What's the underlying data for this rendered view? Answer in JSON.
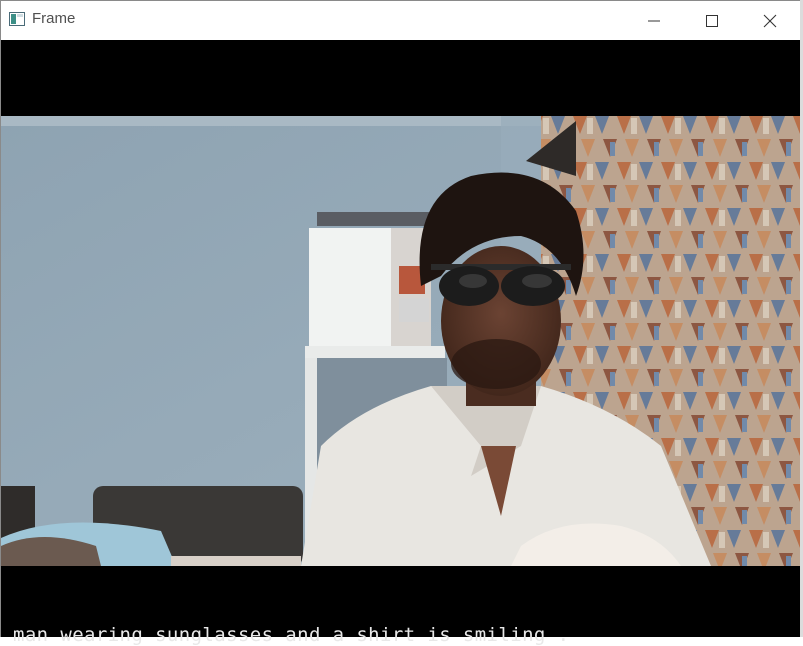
{
  "window": {
    "title": "Frame",
    "icons": {
      "app": "app-window-icon",
      "minimize": "minimize-icon",
      "maximize": "maximize-icon",
      "close": "close-icon"
    }
  },
  "video": {
    "caption": "man wearing sunglasses and a shirt is smiling ."
  },
  "colors": {
    "wall": "#93a6b4",
    "curtain": "#c9a589",
    "shirt": "#e9e8e4",
    "letterbox": "#000000"
  }
}
